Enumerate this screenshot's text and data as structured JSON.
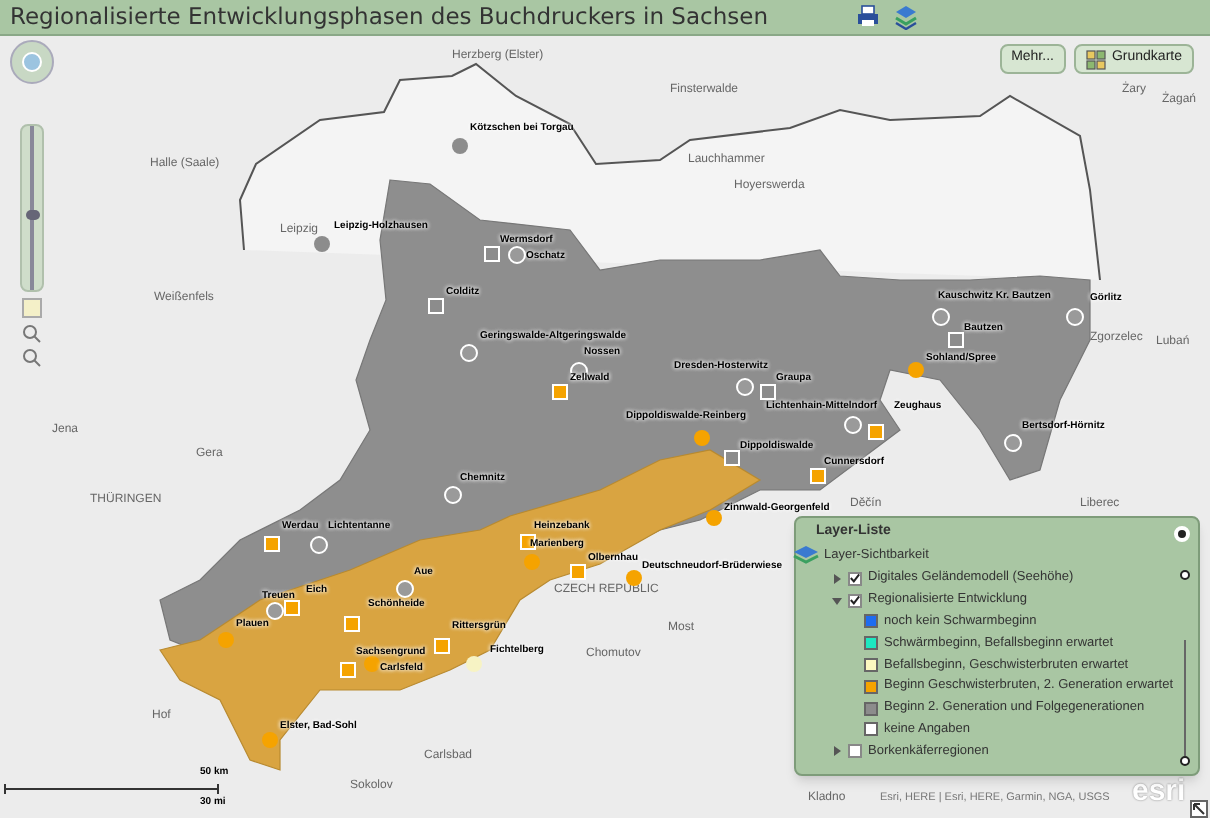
{
  "title": "Regionalisierte Entwicklungsphasen des Buchdruckers in Sachsen",
  "buttons": [
    {
      "kind": "more",
      "label": "Mehr..."
    },
    {
      "kind": "basemap",
      "label": "Grundkarte"
    }
  ],
  "zoom": {
    "level": 0.45
  },
  "places": [
    "Herzberg (Elster)",
    "Finsterwalde",
    "Lauchhammer",
    "Hoyerswerda",
    "Żary",
    "Żagań",
    "Halle (Saale)",
    "Leipzig",
    "Weißenfels",
    "Jena",
    "Gera",
    "THÜRINGEN",
    "Hof",
    "Carlsbad",
    "Sokolov",
    "Chomutov",
    "Most",
    "CZECH REPUBLIC",
    "Děčín",
    "Liberec",
    "Lubań",
    "Zgorzelec",
    "Kladno"
  ],
  "stations": [
    {
      "label": "Kötzschen bei Torgau",
      "kind": "circle",
      "color": "#8c8c8c"
    },
    {
      "label": "Leipzig-Holzhausen",
      "kind": "circle",
      "color": "#8c8c8c"
    },
    {
      "label": "Wermsdorf",
      "kind": "square",
      "color": "#8c8c8c"
    },
    {
      "label": "Oschatz",
      "kind": "ring",
      "color": "#ffffff"
    },
    {
      "label": "Colditz",
      "kind": "square",
      "color": "#8c8c8c"
    },
    {
      "label": "Kauschwitz Kr. Bautzen",
      "kind": "ring",
      "color": "#ffffff"
    },
    {
      "label": "Görlitz",
      "kind": "ring",
      "color": "#ffffff"
    },
    {
      "label": "Bautzen",
      "kind": "square",
      "color": "#8c8c8c"
    },
    {
      "label": "Geringswalde-Altgeringswalde",
      "kind": "ring",
      "color": "#ffffff"
    },
    {
      "label": "Nossen",
      "kind": "ring",
      "color": "#ffffff"
    },
    {
      "label": "Sohland/Spree",
      "kind": "circle",
      "color": "#f5a300"
    },
    {
      "label": "Zellwald",
      "kind": "square",
      "color": "#f5a300"
    },
    {
      "label": "Dresden-Hosterwitz",
      "kind": "ring",
      "color": "#ffffff"
    },
    {
      "label": "Graupa",
      "kind": "square",
      "color": "#8c8c8c"
    },
    {
      "label": "Dippoldiswalde-Reinberg",
      "kind": "circle",
      "color": "#f5a300"
    },
    {
      "label": "Lichtenhain-Mittelndorf",
      "kind": "ring",
      "color": "#ffffff"
    },
    {
      "label": "Zeughaus",
      "kind": "square",
      "color": "#f5a300"
    },
    {
      "label": "Bertsdorf-Hörnitz",
      "kind": "ring",
      "color": "#ffffff"
    },
    {
      "label": "Dippoldiswalde",
      "kind": "square",
      "color": "#8c8c8c"
    },
    {
      "label": "Cunnersdorf",
      "kind": "square",
      "color": "#f5a300"
    },
    {
      "label": "Chemnitz",
      "kind": "ring",
      "color": "#ffffff"
    },
    {
      "label": "Zinnwald-Georgenfeld",
      "kind": "circle",
      "color": "#f5a300"
    },
    {
      "label": "Werdau",
      "kind": "square",
      "color": "#f5a300"
    },
    {
      "label": "Lichtentanne",
      "kind": "ring",
      "color": "#ffffff"
    },
    {
      "label": "Heinzebank",
      "kind": "square",
      "color": "#f5a300"
    },
    {
      "label": "Marienberg",
      "kind": "circle",
      "color": "#f5a300"
    },
    {
      "label": "Olbernhau",
      "kind": "square",
      "color": "#f5a300"
    },
    {
      "label": "Deutschneudorf-Brüderwiese",
      "kind": "circle",
      "color": "#f5a300"
    },
    {
      "label": "Aue",
      "kind": "ring",
      "color": "#ffffff"
    },
    {
      "label": "Treuen",
      "kind": "ring",
      "color": "#ffffff"
    },
    {
      "label": "Eich",
      "kind": "square",
      "color": "#f5a300"
    },
    {
      "label": "Schönheide",
      "kind": "square",
      "color": "#f5a300"
    },
    {
      "label": "Plauen",
      "kind": "circle",
      "color": "#f5a300"
    },
    {
      "label": "Rittersgrün",
      "kind": "square",
      "color": "#f5a300"
    },
    {
      "label": "Sachsengrund",
      "kind": "square",
      "color": "#f5a300"
    },
    {
      "label": "Fichtelberg",
      "kind": "circle",
      "color": "#f7f3c4"
    },
    {
      "label": "Carlsfeld",
      "kind": "circle",
      "color": "#f5a300"
    },
    {
      "label": "Elster, Bad-Sohl",
      "kind": "circle",
      "color": "#f5a300"
    }
  ],
  "scale": {
    "metric": "50 km",
    "imperial": "30 mi"
  },
  "attribution": "Esri, HERE | Esri, HERE, Garmin, NGA, USGS",
  "logo": "esri",
  "layer_panel": {
    "title": "Layer-Liste",
    "subtitle": "Layer-Sichtbarkeit",
    "layers": [
      {
        "label": "Digitales Geländemodell (Seehöhe)",
        "checked": true,
        "expanded": false
      },
      {
        "label": "Regionalisierte Entwicklung",
        "checked": true,
        "expanded": true,
        "children": [
          {
            "label": "noch kein Schwarmbeginn",
            "color": "#1e6cf0"
          },
          {
            "label": "Schwärmbeginn, Befallsbeginn erwartet",
            "color": "#1ee8c0"
          },
          {
            "label": "Befallsbeginn, Geschwisterbruten erwartet",
            "color": "#fcf8c0"
          },
          {
            "label": "Beginn Geschwisterbruten, 2. Generation erwartet",
            "color": "#f5a300"
          },
          {
            "label": "Beginn 2. Generation und Folgegenerationen",
            "color": "#8c8c8c"
          },
          {
            "label": "keine Angaben",
            "color": "#ffffff"
          }
        ]
      },
      {
        "label": "Borkenkäferregionen",
        "checked": false,
        "expanded": false
      }
    ]
  }
}
